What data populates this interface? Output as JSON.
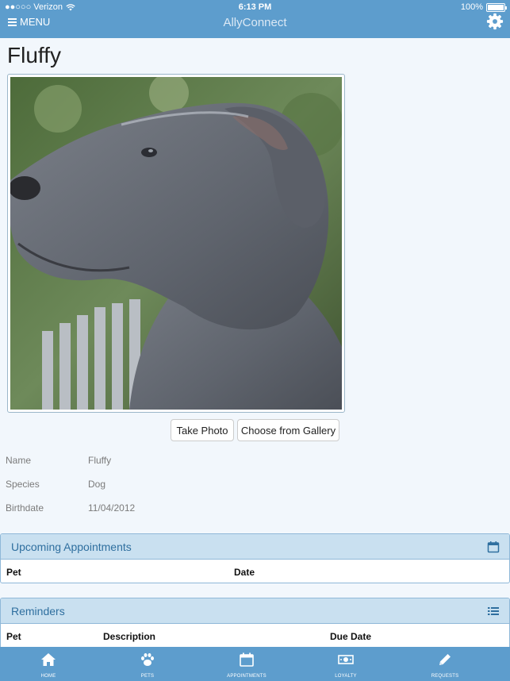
{
  "status_bar": {
    "carrier": "●●○○○ Verizon",
    "time": "6:13 PM",
    "battery": "100%"
  },
  "nav": {
    "menu_label": "MENU",
    "app_title": "AllyConnect",
    "menu_icon": "hamburger-icon",
    "settings_icon": "gear-icon"
  },
  "pet": {
    "title": "Fluffy",
    "take_photo_label": "Take Photo",
    "gallery_label": "Choose from Gallery",
    "details": [
      {
        "key": "Name",
        "value": "Fluffy"
      },
      {
        "key": "Species",
        "value": "Dog"
      },
      {
        "key": "Birthdate",
        "value": "11/04/2012"
      }
    ]
  },
  "appointments": {
    "title": "Upcoming Appointments",
    "icon": "calendar-icon",
    "columns": [
      "Pet",
      "Date"
    ]
  },
  "reminders": {
    "title": "Reminders",
    "icon": "list-icon",
    "columns": [
      "Pet",
      "Description",
      "Due Date"
    ]
  },
  "tabbar": {
    "items": [
      {
        "label": "HOME",
        "icon": "home-icon"
      },
      {
        "label": "PETS",
        "icon": "paw-icon"
      },
      {
        "label": "APPOINTMENTS",
        "icon": "calendar-icon"
      },
      {
        "label": "LOYALTY",
        "icon": "money-icon"
      },
      {
        "label": "REQUESTS",
        "icon": "pencil-icon"
      }
    ]
  },
  "colors": {
    "bar": "#5d9dcd",
    "panel_header": "#c9e0f0",
    "background": "#f2f7fc"
  }
}
